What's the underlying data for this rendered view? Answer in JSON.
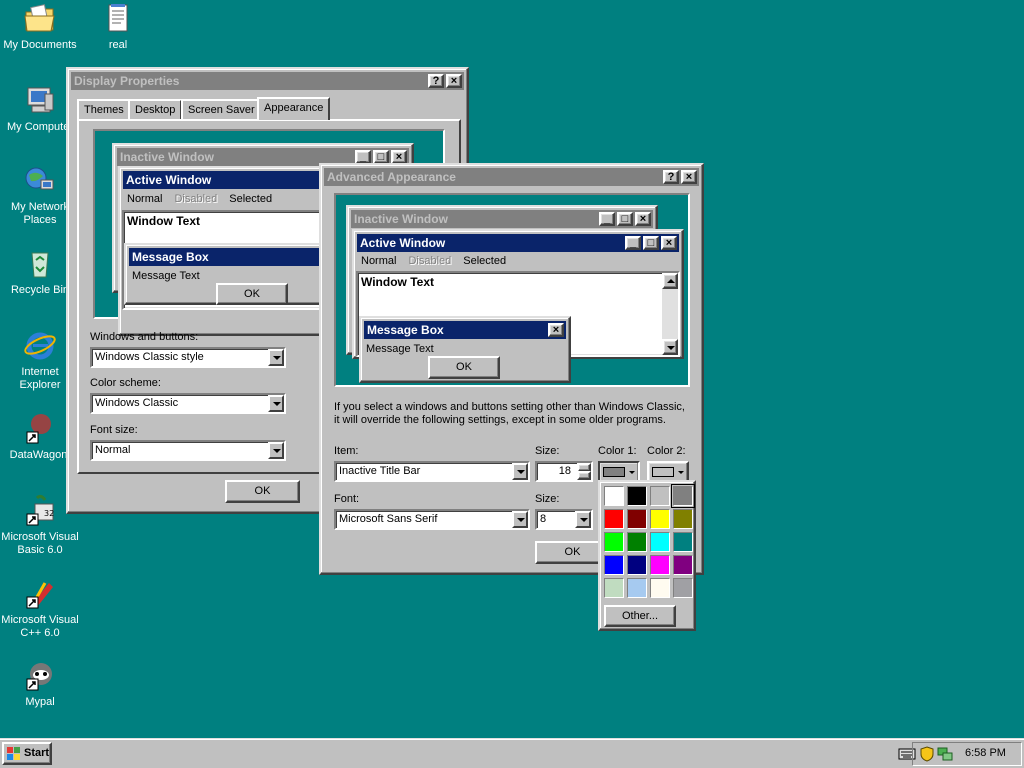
{
  "desktop": {
    "icons": [
      {
        "label": "My Documents",
        "icon": "folder-documents-icon"
      },
      {
        "label": "real",
        "icon": "text-file-icon"
      },
      {
        "label": "My Computer",
        "icon": "computer-icon"
      },
      {
        "label": "My Network Places",
        "icon": "network-places-icon"
      },
      {
        "label": "Recycle Bin",
        "icon": "recycle-bin-icon"
      },
      {
        "label": "Internet Explorer",
        "icon": "internet-explorer-icon"
      },
      {
        "label": "DataWagon.",
        "icon": "datawagon-shortcut-icon"
      },
      {
        "label": "Microsoft Visual Basic 6.0",
        "icon": "visual-basic-icon"
      },
      {
        "label": "Microsoft Visual C++ 6.0",
        "icon": "visual-cpp-icon"
      },
      {
        "label": "Mypal",
        "icon": "mypal-browser-icon"
      }
    ]
  },
  "display_properties": {
    "title": "Display Properties",
    "help_glyph": "?",
    "close_glyph": "×",
    "tabs": [
      "Themes",
      "Desktop",
      "Screen Saver",
      "Appearance"
    ],
    "selected_tab": "Appearance",
    "preview": {
      "inactive_title": "Inactive Window",
      "active_title": "Active Window",
      "menu": [
        "Normal",
        "Disabled",
        "Selected"
      ],
      "window_text": "Window Text",
      "msgbox_title": "Message Box",
      "msgbox_text": "Message Text",
      "ok": "OK"
    },
    "windows_buttons_label": "Windows and buttons:",
    "windows_buttons_value": "Windows Classic style",
    "color_scheme_label": "Color scheme:",
    "color_scheme_value": "Windows Classic",
    "font_size_label": "Font size:",
    "font_size_value": "Normal",
    "ok": "OK"
  },
  "advanced": {
    "title": "Advanced Appearance",
    "help_glyph": "?",
    "close_glyph": "×",
    "preview": {
      "inactive_title": "Inactive Window",
      "active_title": "Active Window",
      "menu": [
        "Normal",
        "Disabled",
        "Selected"
      ],
      "window_text": "Window Text",
      "msgbox_title": "Message Box",
      "msgbox_text": "Message Text",
      "ok": "OK"
    },
    "info_line1": "If you select a windows and buttons setting other than Windows Classic,",
    "info_line2": "it will override the following settings, except in some older programs.",
    "item_label": "Item:",
    "item_value": "Inactive Title Bar",
    "size_label": "Size:",
    "size_value": "18",
    "color1_label": "Color 1:",
    "color2_label": "Color 2:",
    "font_label": "Font:",
    "font_value": "Microsoft Sans Serif",
    "font_size_label": "Size:",
    "font_size_value": "8",
    "ok": "OK"
  },
  "palette": {
    "colors": [
      "#ffffff",
      "#000000",
      "#c0c0c0",
      "#808080",
      "#ff0000",
      "#800000",
      "#ffff00",
      "#808000",
      "#00ff00",
      "#008000",
      "#00ffff",
      "#008080",
      "#0000ff",
      "#000080",
      "#ff00ff",
      "#800080",
      "#c0dcc0",
      "#a6caf0",
      "#fffbf0",
      "#a0a0a4"
    ],
    "selected_index": 3,
    "other_label": "Other..."
  },
  "taskbar": {
    "start_label": "Start",
    "clock": "6:58 PM"
  },
  "colors": {
    "desktop": "#008080",
    "active_title": "#0a246a",
    "inactive_title": "#808080",
    "face": "#c0c0c0"
  }
}
